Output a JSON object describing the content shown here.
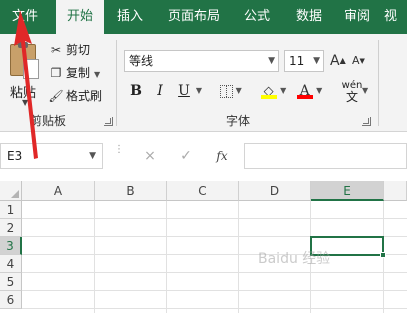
{
  "tabs": {
    "file": "文件",
    "home": "开始",
    "insert": "插入",
    "page_layout": "页面布局",
    "formulas": "公式",
    "data": "数据",
    "review": "审阅",
    "view": "视"
  },
  "clipboard": {
    "paste": "粘贴",
    "cut": "剪切",
    "copy": "复制",
    "format_painter": "格式刷",
    "group_label": "剪贴板"
  },
  "font": {
    "font_name": "等线",
    "font_size": "11",
    "increase": "A",
    "decrease": "A",
    "bold": "B",
    "italic": "I",
    "underline": "U",
    "phonetic_top": "wén",
    "phonetic_bottom": "文",
    "group_label": "字体"
  },
  "formula_bar": {
    "name_box": "E3",
    "cancel": "×",
    "enter": "✓",
    "fx": "fx",
    "formula": ""
  },
  "sheet": {
    "columns": [
      "A",
      "B",
      "C",
      "D",
      "E"
    ],
    "rows": [
      "1",
      "2",
      "3",
      "4",
      "5",
      "6"
    ],
    "active_cell": "E3",
    "selected_column": "E",
    "selected_row": "3"
  },
  "watermark": {
    "text": "Baidu 经验"
  },
  "colors": {
    "accent": "#217346",
    "ribbon_bg": "#f3f3f3",
    "annotation_arrow": "#e02828",
    "fill_color": "#ffff00",
    "font_color": "#ff0000"
  },
  "icons": {
    "cut": "scissors-icon",
    "copy": "copy-icon",
    "format_painter": "paintbrush-icon",
    "paste": "clipboard-icon",
    "borders": "border-icon",
    "fill_color": "paint-bucket-icon",
    "font_color": "font-color-icon",
    "phonetic": "phonetic-guide-icon"
  }
}
